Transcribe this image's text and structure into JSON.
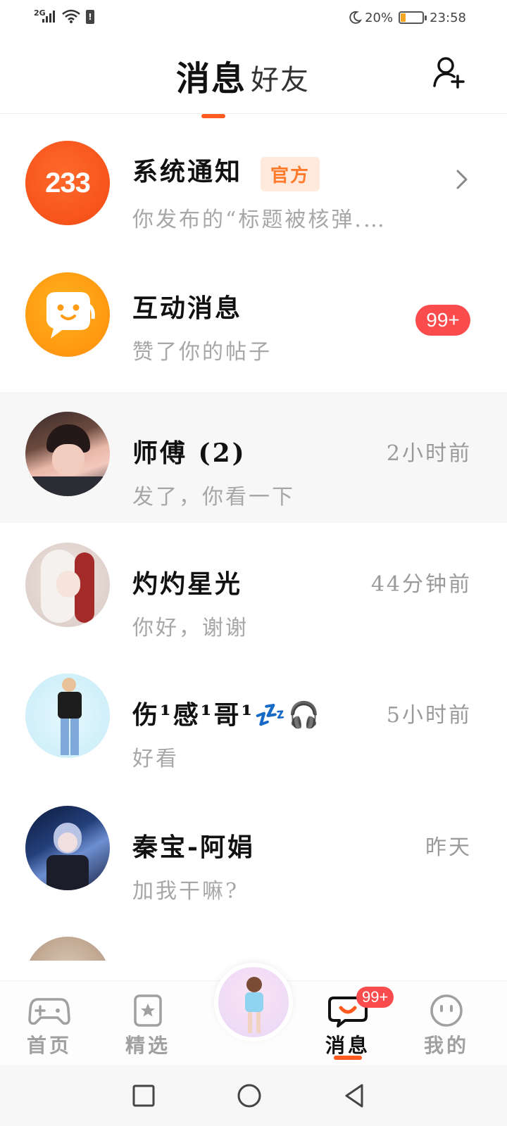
{
  "status_bar": {
    "network": "2G",
    "battery_percent": "20%",
    "battery_level": 0.2,
    "time": "23:58"
  },
  "header": {
    "tabs": [
      {
        "label": "消息",
        "active": true
      },
      {
        "label": "好友",
        "active": false
      }
    ],
    "add_friend_icon": "add-user-icon"
  },
  "colors": {
    "accent": "#ff5a1f",
    "badge_red": "#fa4c4c",
    "official_bg": "#ffe9dd",
    "official_text": "#ff7a2b"
  },
  "messages": [
    {
      "name": "系统通知",
      "tag": "官方",
      "preview": "你发布的“标题被核弹.…",
      "avatar_text": "233",
      "avatar": "app-logo-233"
    },
    {
      "name": "互动消息",
      "preview": "赞了你的帖子",
      "badge": "99+",
      "avatar": "chat-bubble-smile-icon"
    },
    {
      "name": "师傅 (2)",
      "preview": "发了，你看一下",
      "time": "2小时前",
      "avatar": "user-avatar"
    },
    {
      "name": "灼灼星光",
      "preview": "你好，谢谢",
      "time": "44分钟前",
      "avatar": "user-avatar"
    },
    {
      "name": "伤¹感¹哥¹💤🎧",
      "preview": "好看",
      "time": "5小时前",
      "avatar": "user-avatar"
    },
    {
      "name": "秦宝-阿娟",
      "preview": "加我干嘛?",
      "time": "昨天",
      "avatar": "user-avatar"
    }
  ],
  "bottom_nav": {
    "items": [
      {
        "label": "首页",
        "icon": "gamepad-icon"
      },
      {
        "label": "精选",
        "icon": "star-bookmark-icon"
      },
      {
        "label": "消息",
        "icon": "chat-smile-icon",
        "badge": "99+",
        "active": true
      },
      {
        "label": "我的",
        "icon": "face-icon"
      }
    ]
  },
  "system_nav": {
    "buttons": [
      "recents-square-icon",
      "home-circle-icon",
      "back-triangle-icon"
    ]
  }
}
